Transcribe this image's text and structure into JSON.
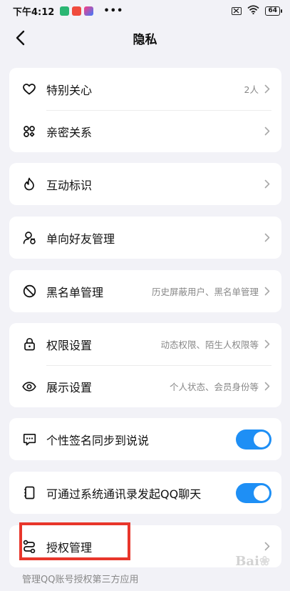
{
  "status_bar": {
    "time": "下午4:12",
    "more": "•••",
    "battery": "64"
  },
  "nav": {
    "title": "隐私"
  },
  "groups": [
    {
      "rows": [
        {
          "label": "特别关心",
          "value": "2人",
          "icon": "heart-icon"
        },
        {
          "label": "亲密关系",
          "value": "",
          "icon": "intimacy-icon"
        }
      ]
    },
    {
      "rows": [
        {
          "label": "互动标识",
          "value": "",
          "icon": "flame-icon"
        }
      ]
    },
    {
      "rows": [
        {
          "label": "单向好友管理",
          "value": "",
          "icon": "user-manage-icon"
        }
      ]
    },
    {
      "rows": [
        {
          "label": "黑名单管理",
          "value": "历史屏蔽用户、黑名单管理",
          "icon": "block-icon"
        }
      ]
    },
    {
      "rows": [
        {
          "label": "权限设置",
          "value": "动态权限、陌生人权限等",
          "icon": "lock-icon"
        },
        {
          "label": "展示设置",
          "value": "个人状态、会员身份等",
          "icon": "eye-icon"
        }
      ]
    },
    {
      "rows": [
        {
          "label": "个性签名同步到说说",
          "toggle": true,
          "icon": "signature-icon"
        }
      ]
    },
    {
      "rows": [
        {
          "label": "可通过系统通讯录发起QQ聊天",
          "toggle": true,
          "icon": "contacts-icon"
        }
      ]
    },
    {
      "rows": [
        {
          "label": "授权管理",
          "value": "",
          "icon": "authorization-icon"
        }
      ]
    }
  ],
  "footnote": "管理QQ账号授权第三方应用",
  "colors": {
    "toggle_on": "#1e8ff5",
    "highlight": "#e8362b",
    "background": "#f2f2f7"
  }
}
